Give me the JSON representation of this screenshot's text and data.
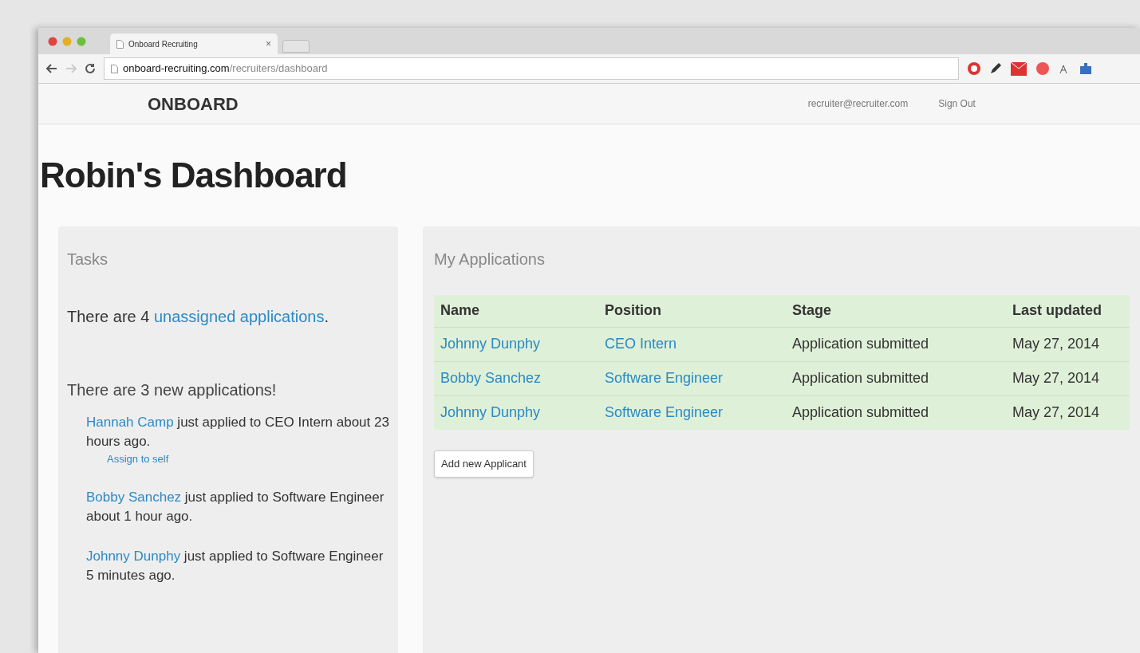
{
  "browser": {
    "tab_title": "Onboard Recruiting",
    "tab_close": "×",
    "url_host": "onboard-recruiting.com",
    "url_path": "/recruiters/dashboard"
  },
  "navbar": {
    "brand": "ONBOARD",
    "email": "recruiter@recruiter.com",
    "sign_out": "Sign Out"
  },
  "page_title": "Robin's Dashboard",
  "tasks": {
    "title": "Tasks",
    "unassigned": {
      "before": "There are 4 ",
      "link": "unassigned applications",
      "after": "."
    },
    "new_heading": "There are 3 new applications!",
    "items": [
      {
        "name": "Hannah Camp",
        "text": " just applied to CEO Intern about 23 hours ago.",
        "action": "Assign to self"
      },
      {
        "name": "Bobby Sanchez",
        "text": " just applied to Software Engineer about 1 hour ago."
      },
      {
        "name": "Johnny Dunphy",
        "text": " just applied to Software Engineer 5 minutes ago."
      }
    ]
  },
  "applications": {
    "title": "My Applications",
    "columns": [
      "Name",
      "Position",
      "Stage",
      "Last updated"
    ],
    "rows": [
      [
        "Johnny Dunphy",
        "CEO Intern",
        "Application submitted",
        "May 27, 2014"
      ],
      [
        "Bobby Sanchez",
        "Software Engineer",
        "Application submitted",
        "May 27, 2014"
      ],
      [
        "Johnny Dunphy",
        "Software Engineer",
        "Application submitted",
        "May 27, 2014"
      ]
    ],
    "add_button": "Add new Applicant"
  }
}
